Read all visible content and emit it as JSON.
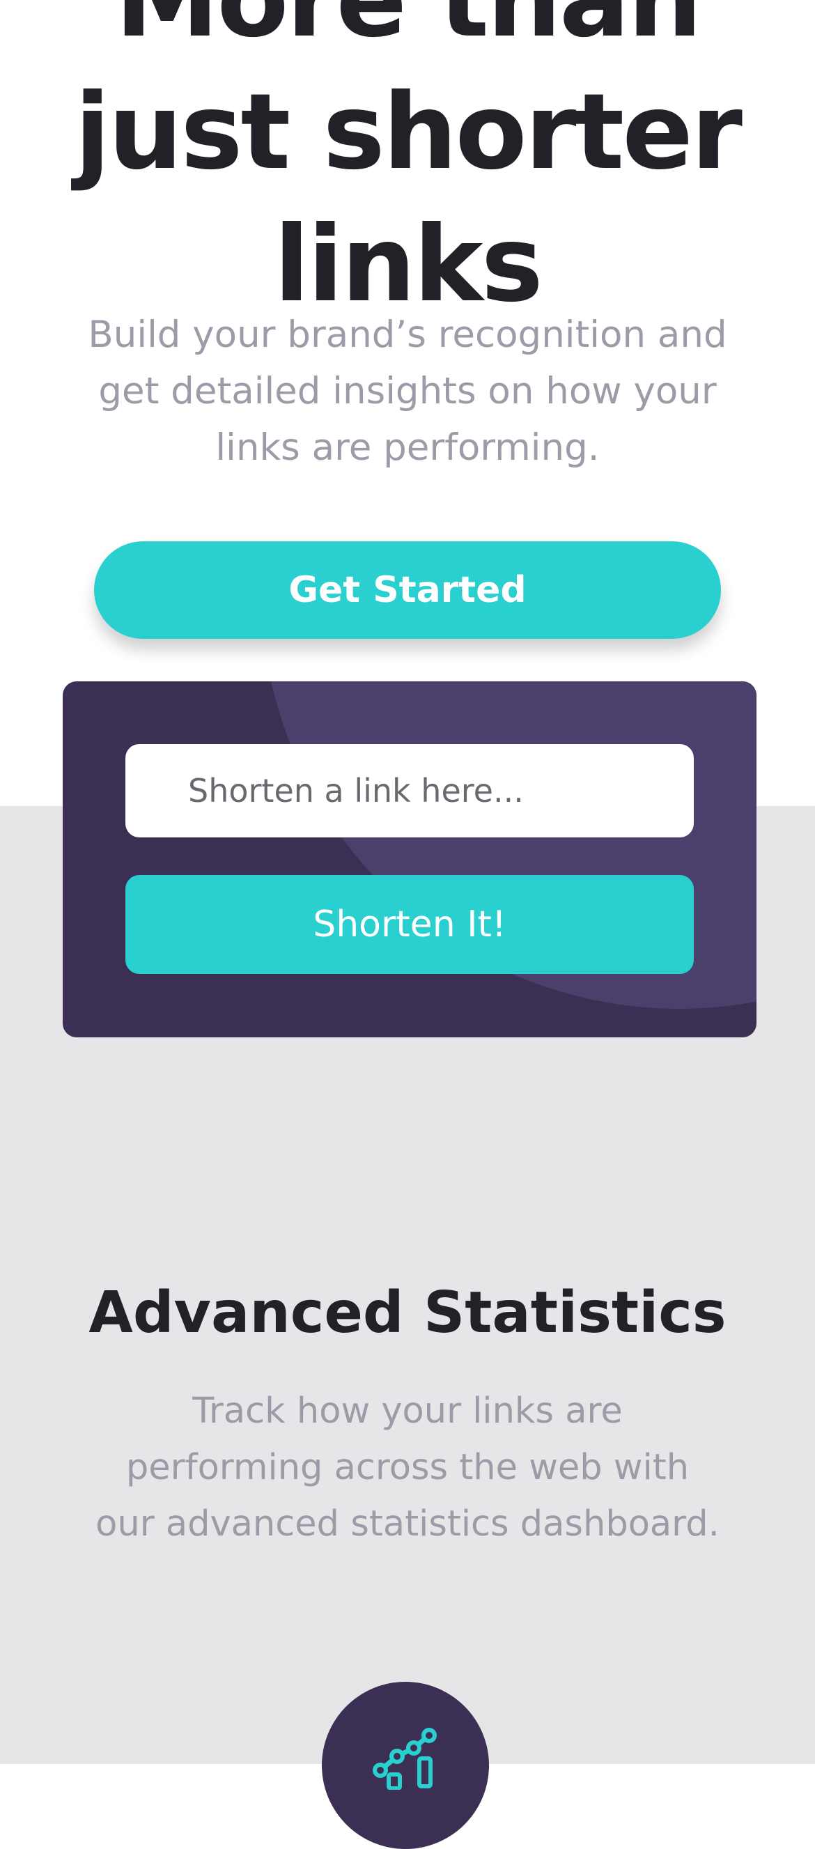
{
  "hero": {
    "title": "More than just shorter links",
    "subtitle": "Build your brand’s recognition and get detailed insights on how your links are performing.",
    "cta_label": "Get Started"
  },
  "shorten": {
    "placeholder": "Shorten a link here...",
    "button_label": "Shorten It!"
  },
  "statistics": {
    "title": "Advanced Statistics",
    "subtitle": "Track how your links are performing across the web with our advanced statistics dashboard.",
    "feature_icon": "chart-icon"
  },
  "colors": {
    "accent": "#2acfcf",
    "dark_violet": "#3b3054",
    "heading": "#232127",
    "muted_text": "#9e9aa7",
    "section_bg": "#e6e6e8"
  }
}
